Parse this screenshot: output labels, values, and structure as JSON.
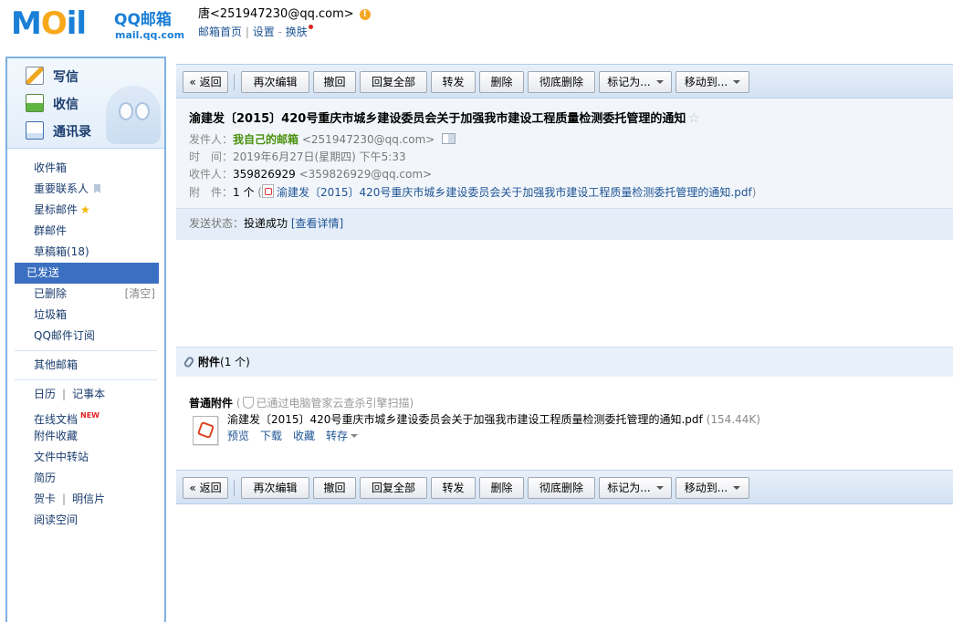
{
  "brand": {
    "logo_text": "MOil",
    "product": "QQ邮箱",
    "domain": "mail.qq.com"
  },
  "user": {
    "display": "唐<251947230@qq.com>",
    "links": {
      "home": "邮箱首页",
      "sep": "|",
      "settings": "设置",
      "dash": "-",
      "skin": "换肤"
    }
  },
  "sidebar": {
    "compose": [
      {
        "label": "写信",
        "icon": "write-icon"
      },
      {
        "label": "收信",
        "icon": "inbox-icon"
      },
      {
        "label": "通讯录",
        "icon": "contacts-icon"
      }
    ],
    "folders": {
      "inbox": "收件箱",
      "important": "重要联系人",
      "starred": "星标邮件",
      "group": "群邮件",
      "drafts": "草稿箱(18)",
      "sent": "已发送",
      "deleted": "已删除",
      "deleted_action": "[清空]",
      "spam": "垃圾箱",
      "subscriptions": "QQ邮件订阅",
      "other": "其他邮箱",
      "calendar": "日历",
      "notes": "记事本",
      "online_docs": "在线文档",
      "new_badge": "NEW",
      "attachments": "附件收藏",
      "file_transfer": "文件中转站",
      "resume": "简历",
      "cards": "贺卡",
      "postcards": "明信片",
      "reading": "阅读空间",
      "sep": "|"
    }
  },
  "toolbar": {
    "back": "« 返回",
    "reedit": "再次编辑",
    "recall": "撤回",
    "reply_all": "回复全部",
    "forward": "转发",
    "delete": "删除",
    "delete_permanent": "彻底删除",
    "mark_as": "标记为...",
    "move_to": "移动到..."
  },
  "mail": {
    "subject": "渝建发〔2015〕420号重庆市城乡建设委员会关于加强我市建设工程质量检测委托管理的通知",
    "from_label": "发件人：",
    "from_name": "我自己的邮箱",
    "from_addr": "<251947230@qq.com>",
    "time_label": "时　间：",
    "time_value": "2019年6月27日(星期四) 下午5:33",
    "to_label": "收件人：",
    "to_name": "359826929",
    "to_addr": "<359826929@qq.com>",
    "attach_label": "附　件：",
    "attach_count": "1 个",
    "attach_open": "(",
    "attach_file": "渝建发〔2015〕420号重庆市城乡建设委员会关于加强我市建设工程质量检测委托管理的通知.pdf",
    "attach_close": ")",
    "status_label": "发送状态：",
    "status_value": "投递成功",
    "status_detail": "[查看详情]"
  },
  "attachments": {
    "title": "附件",
    "count": "(1 个)",
    "kind": "普通附件",
    "scan": "已通过电脑管家云查杀引擎扫描)",
    "scan_open": "(",
    "file_name": "渝建发〔2015〕420号重庆市城乡建设委员会关于加强我市建设工程质量检测委托管理的通知.pdf",
    "file_size": "(154.44K)",
    "actions": {
      "preview": "预览",
      "download": "下载",
      "collect": "收藏",
      "save_to": "转存"
    }
  },
  "colors": {
    "accent": "#1e5494",
    "active_folder": "#3b6fc1",
    "sender_green": "#49900d"
  }
}
